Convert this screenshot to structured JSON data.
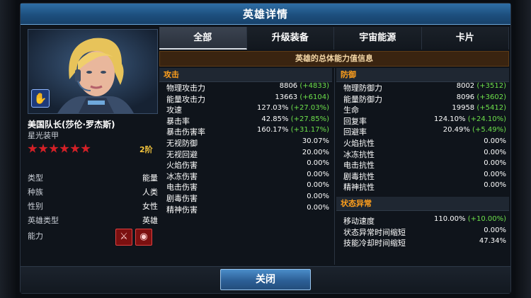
{
  "window": {
    "title": "英雄详情"
  },
  "hero": {
    "name": "美国队长(莎伦·罗杰斯)",
    "subtitle": "星光装甲",
    "stars": 6,
    "rank": "2阶",
    "class_icon": "energy-fist-icon",
    "attributes": [
      {
        "label": "类型",
        "value": "能量"
      },
      {
        "label": "种族",
        "value": "人类"
      },
      {
        "label": "性别",
        "value": "女性"
      },
      {
        "label": "英雄类型",
        "value": "英雄"
      }
    ],
    "ability_label": "能力",
    "abilities": [
      "bleed-ability-icon",
      "shield-ability-icon"
    ]
  },
  "tabs": [
    "全部",
    "升级装备",
    "宇宙能源",
    "卡片"
  ],
  "active_tab": 0,
  "summary_title": "英雄的总体能力值信息",
  "attack": {
    "title": "攻击",
    "rows": [
      {
        "label": "物理攻击力",
        "value": "8806",
        "bonus": "(+4833)"
      },
      {
        "label": "能量攻击力",
        "value": "13663",
        "bonus": "(+6104)"
      },
      {
        "label": "攻速",
        "value": "127.03%",
        "bonus": "(+27.03%)"
      },
      {
        "label": "暴击率",
        "value": "42.85%",
        "bonus": "(+27.85%)"
      },
      {
        "label": "暴击伤害率",
        "value": "160.17%",
        "bonus": "(+31.17%)"
      },
      {
        "label": "无视防御",
        "value": "30.07%",
        "bonus": ""
      },
      {
        "label": "无视回避",
        "value": "20.00%",
        "bonus": ""
      },
      {
        "label": "火焰伤害",
        "value": "0.00%",
        "bonus": ""
      },
      {
        "label": "冰冻伤害",
        "value": "0.00%",
        "bonus": ""
      },
      {
        "label": "电击伤害",
        "value": "0.00%",
        "bonus": ""
      },
      {
        "label": "剧毒伤害",
        "value": "0.00%",
        "bonus": ""
      },
      {
        "label": "精神伤害",
        "value": "0.00%",
        "bonus": ""
      }
    ]
  },
  "defense": {
    "title": "防御",
    "rows": [
      {
        "label": "物理防御力",
        "value": "8002",
        "bonus": "(+3512)"
      },
      {
        "label": "能量防御力",
        "value": "8096",
        "bonus": "(+3602)"
      },
      {
        "label": "生命",
        "value": "19958",
        "bonus": "(+5412)"
      },
      {
        "label": "回复率",
        "value": "124.10%",
        "bonus": "(+24.10%)"
      },
      {
        "label": "回避率",
        "value": "20.49%",
        "bonus": "(+5.49%)"
      },
      {
        "label": "火焰抗性",
        "value": "0.00%",
        "bonus": ""
      },
      {
        "label": "冰冻抗性",
        "value": "0.00%",
        "bonus": ""
      },
      {
        "label": "电击抗性",
        "value": "0.00%",
        "bonus": ""
      },
      {
        "label": "剧毒抗性",
        "value": "0.00%",
        "bonus": ""
      },
      {
        "label": "精神抗性",
        "value": "0.00%",
        "bonus": ""
      }
    ]
  },
  "status": {
    "title": "状态异常",
    "rows": [
      {
        "label": "移动速度",
        "value": "110.00%",
        "bonus": "(+10.00%)"
      },
      {
        "label": "状态异常时间缩短",
        "value": "0.00%",
        "bonus": ""
      },
      {
        "label": "技能冷却时间缩短",
        "value": "47.34%",
        "bonus": ""
      }
    ]
  },
  "close_label": "关闭",
  "colors": {
    "accent": "#ff9f1c",
    "bonus": "#6de04b",
    "title_bar": "#2f6fa6",
    "star": "#d42027",
    "rank": "#f0c23c"
  }
}
